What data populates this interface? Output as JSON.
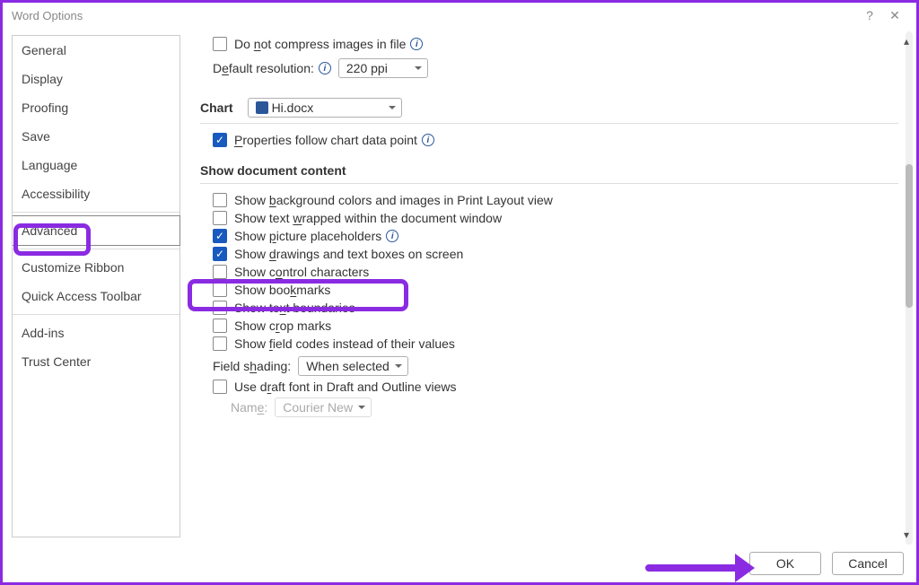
{
  "title": "Word Options",
  "sidebar": {
    "items": [
      {
        "label": "General"
      },
      {
        "label": "Display"
      },
      {
        "label": "Proofing"
      },
      {
        "label": "Save"
      },
      {
        "label": "Language"
      },
      {
        "label": "Accessibility"
      },
      {
        "label": "Advanced",
        "selected": true
      },
      {
        "label": "Customize Ribbon"
      },
      {
        "label": "Quick Access Toolbar"
      },
      {
        "label": "Add-ins"
      },
      {
        "label": "Trust Center"
      }
    ]
  },
  "content": {
    "compress_label_pre": "Do ",
    "compress_under": "n",
    "compress_label_post": "ot compress images in file",
    "res_label_pre": "D",
    "res_under": "e",
    "res_label_post": "fault resolution:",
    "res_value": "220 ppi",
    "chart_label": "Chart",
    "chart_value": "Hi.docx",
    "properties_pre": "",
    "properties_under": "P",
    "properties_post": "roperties follow chart data point",
    "section_doc": "Show document content",
    "bg_pre": "Show ",
    "bg_u": "b",
    "bg_post": "ackground colors and images in Print Layout view",
    "wrap_pre": "Show text ",
    "wrap_u": "w",
    "wrap_post": "rapped within the document window",
    "pic_pre": "Show ",
    "pic_u": "p",
    "pic_post": "icture placeholders",
    "draw_pre": "Show ",
    "draw_u": "d",
    "draw_post": "rawings and text boxes on screen",
    "ctrl_pre": "Show c",
    "ctrl_u": "o",
    "ctrl_post": "ntrol characters",
    "bkmk_pre": "Show boo",
    "bkmk_u": "k",
    "bkmk_post": "marks",
    "bound_pre": "Show te",
    "bound_u": "x",
    "bound_post": "t boundaries",
    "crop_pre": "Show c",
    "crop_u": "r",
    "crop_post": "op marks",
    "field_pre": "Show ",
    "field_u": "f",
    "field_post": "ield codes instead of their values",
    "shading_label_pre": "Field s",
    "shading_u": "h",
    "shading_label_post": "ading:",
    "shading_value": "When selected",
    "draft_pre": "Use d",
    "draft_u": "r",
    "draft_post": "aft font in Draft and Outline views",
    "name_label_pre": "Nam",
    "name_u": "e",
    "name_label_post": ":",
    "name_value": "Courier New"
  },
  "footer": {
    "ok": "OK",
    "cancel": "Cancel"
  }
}
